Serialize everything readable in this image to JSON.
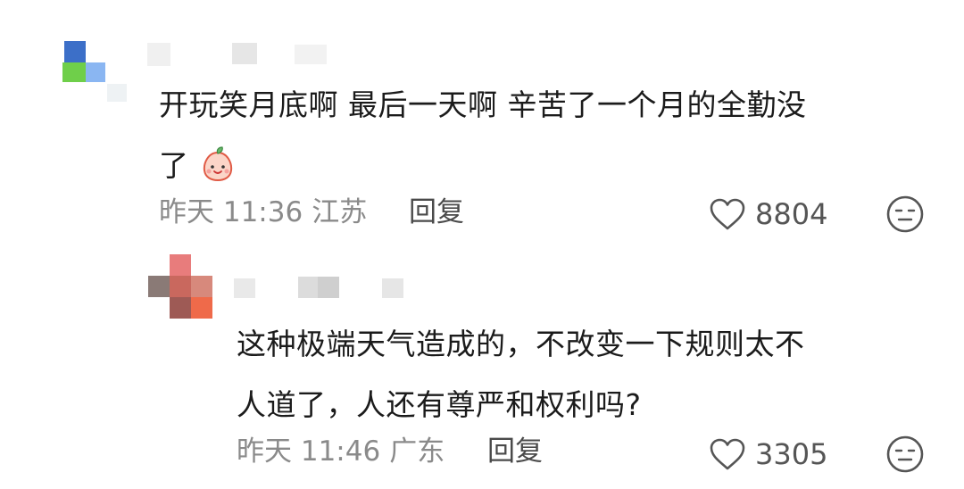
{
  "comments": [
    {
      "text_line1": "开玩笑月底啊 最后一天啊 辛苦了一个月的全勤没",
      "text_line2": "了",
      "emoji": "peach-face-emoji",
      "time": "昨天 11:36",
      "location": "江苏",
      "reply_label": "回复",
      "likes": "8804",
      "dislike_icon": "dislike-face-icon"
    },
    {
      "text_line1": "这种极端天气造成的，不改变一下规则太不",
      "text_line2": "人道了，人还有尊严和权利吗?",
      "time": "昨天 11:46",
      "location": "广东",
      "reply_label": "回复",
      "likes": "3305",
      "dislike_icon": "dislike-face-icon"
    }
  ],
  "colors": {
    "text": "#1b1b1b",
    "meta": "#8a8a8a",
    "reply": "#4a4a4a",
    "icon": "#555555"
  }
}
